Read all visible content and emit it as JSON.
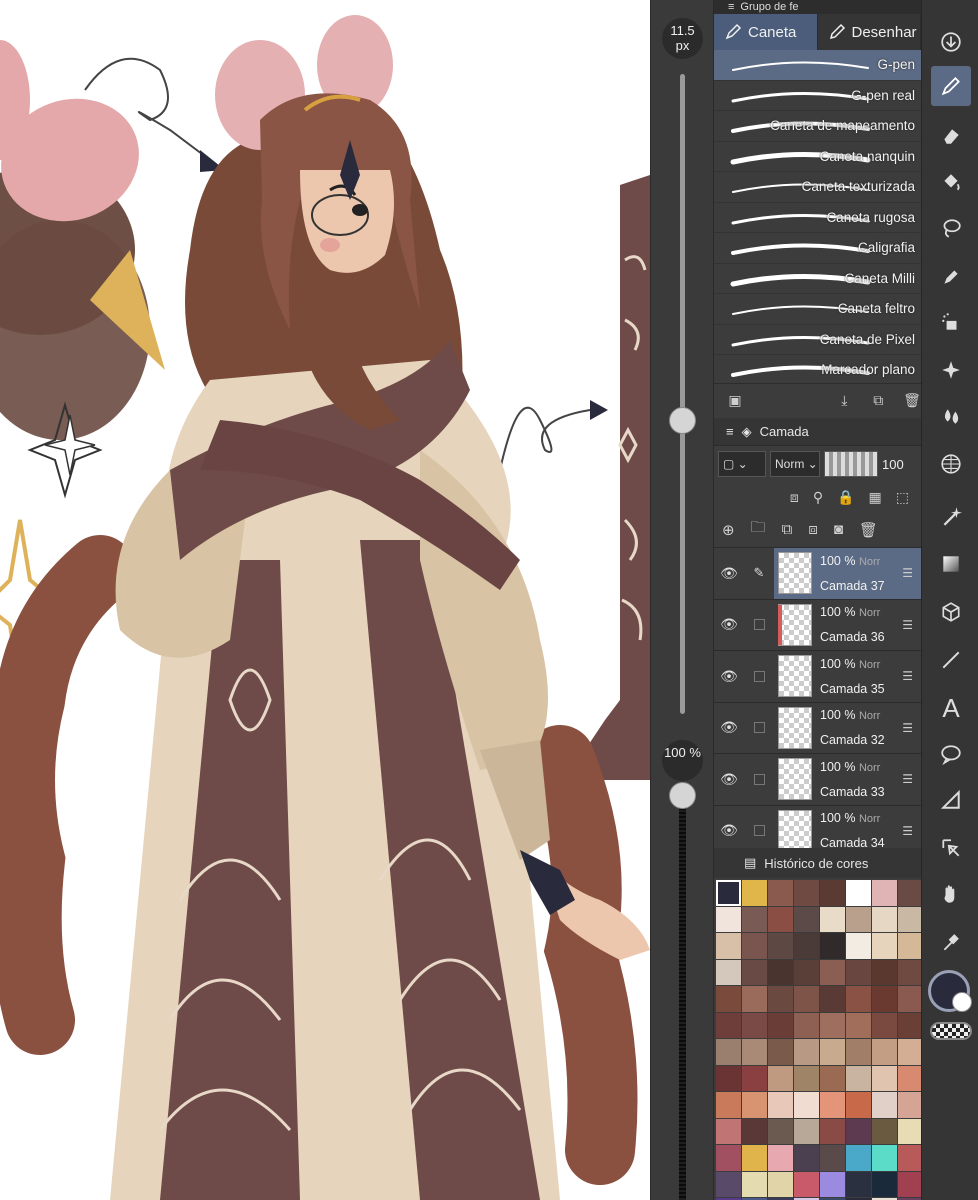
{
  "sliders": {
    "brush_size": "11.5 px",
    "brush_size_fraction": 0.46,
    "opacity": "100 %",
    "opacity_fraction": 1.0
  },
  "subtool_panel": {
    "group_title": "Grupo de fe",
    "tabs": [
      {
        "label": "Caneta",
        "icon": "pen-icon",
        "active": true
      },
      {
        "label": "Desenhar",
        "icon": "pencil-icon",
        "active": false
      }
    ],
    "brushes": [
      {
        "label": "G-pen",
        "selected": true
      },
      {
        "label": "G-pen real",
        "selected": false
      },
      {
        "label": "Caneta de mapeamento",
        "selected": false
      },
      {
        "label": "Caneta nanquin",
        "selected": false
      },
      {
        "label": "Caneta texturizada",
        "selected": false
      },
      {
        "label": "Caneta rugosa",
        "selected": false
      },
      {
        "label": "Caligrafia",
        "selected": false
      },
      {
        "label": "Caneta Milli",
        "selected": false
      },
      {
        "label": "Caneta feltro",
        "selected": false
      },
      {
        "label": "Caneta de Pixel",
        "selected": false
      },
      {
        "label": "Marcador plano",
        "selected": false
      }
    ]
  },
  "layers_panel": {
    "title": "Camada",
    "blend_mode": "Norm",
    "opacity_value": "100",
    "layers": [
      {
        "name": "Camada 37",
        "opacity": "100 %",
        "mode": "Norr",
        "selected": true
      },
      {
        "name": "Camada 36",
        "opacity": "100 %",
        "mode": "Norr",
        "selected": false
      },
      {
        "name": "Camada 35",
        "opacity": "100 %",
        "mode": "Norr",
        "selected": false
      },
      {
        "name": "Camada 32",
        "opacity": "100 %",
        "mode": "Norr",
        "selected": false
      },
      {
        "name": "Camada 33",
        "opacity": "100 %",
        "mode": "Norr",
        "selected": false
      },
      {
        "name": "Camada 34",
        "opacity": "100 %",
        "mode": "Norr",
        "selected": false
      }
    ]
  },
  "color_history": {
    "title": "Histórico de cores",
    "colors": [
      "#2a2a3d",
      "#e0b54a",
      "#8a5a4e",
      "#6e4a42",
      "#5a3a33",
      "#ffffff",
      "#e0b4b4",
      "#6a4a45",
      "#f0e4dc",
      "#7a5a54",
      "#8a4e44",
      "#5c4a48",
      "#e8dcc8",
      "#b8a08c",
      "#e6d6c4",
      "#c8b8a4",
      "#d8c0a8",
      "#7a5550",
      "#5e4844",
      "#4a3a38",
      "#302a2a",
      "#f2ece2",
      "#e6d4bc",
      "#d4b898",
      "#d4c8bc",
      "#6a4a44",
      "#4a3430",
      "#5a3e38",
      "#8a5e52",
      "#6a4640",
      "#5a3830",
      "#6e4a40",
      "#7a4a3c",
      "#9a6a5a",
      "#6a4a40",
      "#7e5448",
      "#5a3a34",
      "#8a5244",
      "#6a3a30",
      "#8a5a50",
      "#6e3e3a",
      "#7a4a46",
      "#6a3e36",
      "#8e6054",
      "#9e6e5e",
      "#a06e5a",
      "#7a4a40",
      "#6a4036",
      "#9a7e6e",
      "#a88a76",
      "#7a5a4a",
      "#b89a84",
      "#c8aa8e",
      "#a07e68",
      "#c49e84",
      "#d4ae94",
      "#6a3434",
      "#8a4040",
      "#c09a80",
      "#a08468",
      "#9a6a52",
      "#c8b4a0",
      "#e0c4b0",
      "#d88a70",
      "#c87a5a",
      "#d89470",
      "#e8c8b8",
      "#f0dcd0",
      "#e49478",
      "#c86a4a",
      "#e0d0c8",
      "#d4a494",
      "#c07474",
      "#5a3838",
      "#6a5a50",
      "#b8a898",
      "#8a4a46",
      "#5e3a50",
      "#6a5a40",
      "#e8dcb4",
      "#a05060",
      "#e0b44a",
      "#e8a8b0",
      "#4a4050",
      "#5a4a4a",
      "#4aa8c8",
      "#5adcc8",
      "#b85a5a",
      "#5a4a6a",
      "#e4dcb0",
      "#e0d4a8",
      "#c85a6a",
      "#9a8ae0",
      "#2a3040",
      "#1a2a3a",
      "#a04050",
      "#5a3a8a",
      "#4a5a8a",
      "#3a3a5a",
      "#d8c8e8",
      "#3a4a6a",
      "#2a2a3a",
      "#e8e0d4",
      "#6a4060"
    ]
  },
  "toolbar": {
    "tools": [
      {
        "icon": "download-icon",
        "active": false
      },
      {
        "icon": "pen-icon",
        "active": true
      },
      {
        "icon": "eraser-icon",
        "active": false
      },
      {
        "icon": "fill-bucket-icon",
        "active": false
      },
      {
        "icon": "lasso-icon",
        "active": false
      },
      {
        "icon": "dropper-pen-icon",
        "active": false
      },
      {
        "icon": "airbrush-icon",
        "active": false
      },
      {
        "icon": "sparkle-icon",
        "active": false
      },
      {
        "icon": "blend-drops-icon",
        "active": false
      },
      {
        "icon": "mesh-grid-icon",
        "active": false
      },
      {
        "icon": "magic-wand-icon",
        "active": false
      },
      {
        "icon": "gradient-icon",
        "active": false
      },
      {
        "icon": "3d-cube-icon",
        "active": false
      },
      {
        "icon": "line-icon",
        "active": false
      },
      {
        "icon": "text-icon",
        "active": false
      },
      {
        "icon": "speech-bubble-icon",
        "active": false
      },
      {
        "icon": "ruler-icon",
        "active": false
      },
      {
        "icon": "move-select-icon",
        "active": false
      },
      {
        "icon": "hand-icon",
        "active": false
      },
      {
        "icon": "eyedropper-icon",
        "active": false
      }
    ],
    "text_tool_glyph": "A",
    "main_color": "#2a2a3d",
    "sub_color": "#ffffff"
  },
  "colors": {
    "accent": "#5c6b85",
    "panel": "#3c3c3c",
    "canvas": "#ffffff"
  }
}
